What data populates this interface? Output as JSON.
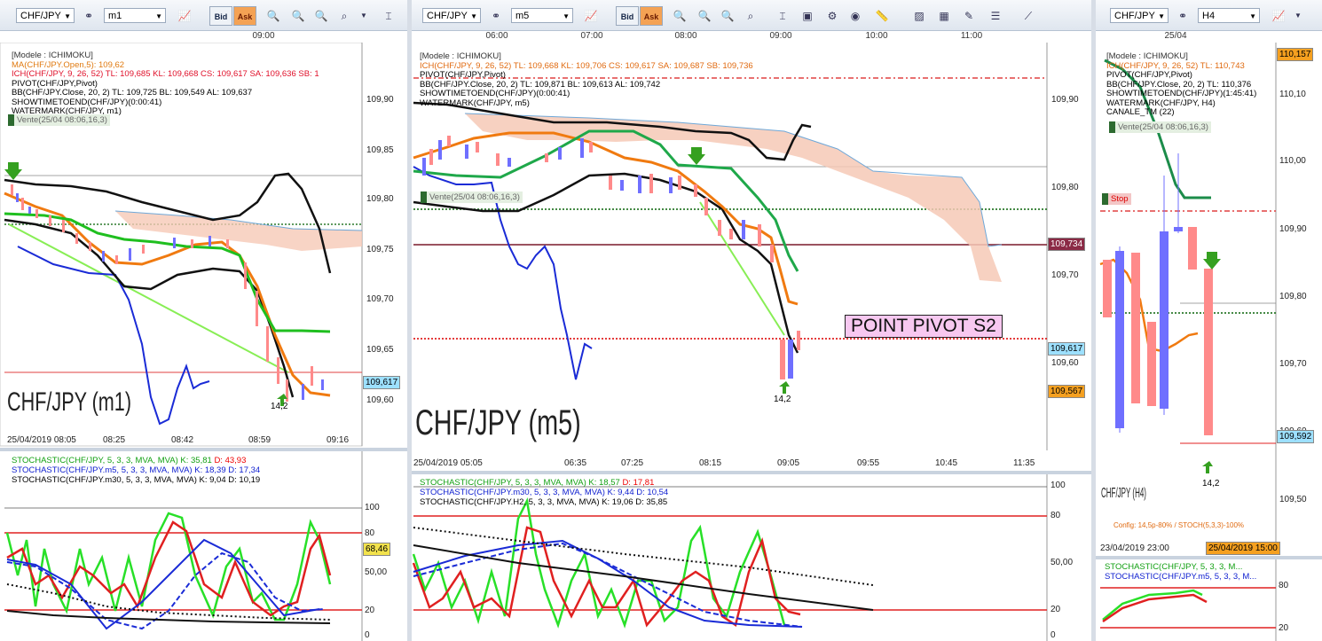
{
  "panels": [
    {
      "symbol": "CHF/JPY",
      "timeframe": "m1",
      "bid_label": "Bid",
      "ask_label": "Ask",
      "top_times": [
        "09:00"
      ],
      "info_lines": [
        "[Modele : ICHIMOKU]",
        "MA(CHF/JPY.Open,5): 109,62",
        "ICH(CHF/JPY, 9, 26, 52)  TL: 109,685  KL: 109,668  CS: 109,617  SA: 109,636  SB: 1",
        "PIVOT(CHF/JPY,Pivot)",
        "BB(CHF/JPY.Close, 20, 2)  TL: 109,725  BL: 109,549  AL: 109,637",
        "SHOWTIMETOEND(CHF/JPY)(0:00:41)",
        "WATERMARK(CHF/JPY, m1)"
      ],
      "vente": "Vente(25/04 08:06,16,3)",
      "y_labels": [
        "109,90",
        "109,85",
        "109,80",
        "109,75",
        "109,70",
        "109,65",
        "109,60"
      ],
      "price_tag": "109,617",
      "watermark": "CHF/JPY (m1)",
      "arrow_label": "14,2",
      "bottom_times": [
        "25/04/2019 08:05",
        "08:25",
        "08:42",
        "08:59",
        "09:16"
      ],
      "stoch_lines": [
        {
          "text": "STOCHASTIC(CHF/JPY, 5, 3, 3, MVA, MVA)",
          "k": "K: 35,81",
          "d": "D: 43,93",
          "color": "#12a012"
        },
        {
          "text": "STOCHASTIC(CHF/JPY.m5, 5, 3, 3, MVA, MVA)",
          "k": "K: 18,39",
          "d": "D: 17,34",
          "color": "#1020d0"
        },
        {
          "text": "STOCHASTIC(CHF/JPY.m30, 5, 3, 3, MVA, MVA)",
          "k": "K: 9,04",
          "d": "D: 10,19",
          "color": "#000000"
        }
      ],
      "stoch_levels": [
        "100",
        "80",
        "50,00",
        "20",
        "0"
      ],
      "stoch_tag": "68,46"
    },
    {
      "symbol": "CHF/JPY",
      "timeframe": "m5",
      "bid_label": "Bid",
      "ask_label": "Ask",
      "top_times": [
        "06:00",
        "07:00",
        "08:00",
        "09:00",
        "10:00",
        "11:00"
      ],
      "info_lines": [
        "[Modele : ICHIMOKU]",
        "ICH(CHF/JPY, 9, 26, 52)  TL: 109,668  KL: 109,706  CS: 109,617  SA: 109,687  SB: 109,736",
        "PIVOT(CHF/JPY,Pivot)",
        "BB(CHF/JPY.Close, 20, 2)  TL: 109,871  BL: 109,613  AL: 109,742",
        "SHOWTIMETOEND(CHF/JPY)(0:00:41)",
        "WATERMARK(CHF/JPY, m5)"
      ],
      "vente": "Vente(25/04 08:06,16,3)",
      "y_labels": [
        "109,90",
        "109,80",
        "109,70",
        "109,60"
      ],
      "price_tags": [
        "109,734",
        "109,617",
        "109,567"
      ],
      "pivot_label": "POINT PIVOT S2",
      "watermark": "CHF/JPY (m5)",
      "arrow_label": "14,2",
      "bottom_times": [
        "25/04/2019 05:05",
        "06:35",
        "07:25",
        "08:15",
        "09:05",
        "09:55",
        "10:45",
        "11:35"
      ],
      "stoch_lines": [
        {
          "text": "STOCHASTIC(CHF/JPY, 5, 3, 3, MVA, MVA)",
          "k": "K: 18,57",
          "d": "D: 17,81",
          "color": "#12a012"
        },
        {
          "text": "STOCHASTIC(CHF/JPY.m30, 5, 3, 3, MVA, MVA)",
          "k": "K: 9,44",
          "d": "D: 10,54",
          "color": "#1020d0"
        },
        {
          "text": "STOCHASTIC(CHF/JPY.H2, 5, 3, 3, MVA, MVA)",
          "k": "K: 19,06",
          "d": "D: 35,85",
          "color": "#000000"
        }
      ],
      "stoch_levels": [
        "100",
        "80",
        "50,00",
        "20",
        "0"
      ]
    },
    {
      "symbol": "CHF/JPY",
      "timeframe": "H4",
      "top_times": [
        "25/04"
      ],
      "info_lines": [
        "[Modele : ICHIMOKU]",
        "ICH(CHF/JPY, 9, 26, 52)  TL: 110,743",
        "PIVOT(CHF/JPY,Pivot)",
        "BB(CHF/JPY.Close, 20, 2)  TL: 110,376",
        "SHOWTIMETOEND(CHF/JPY)(1:45:41)",
        "WATERMARK(CHF/JPY, H4)",
        "CANALE_TM (22)"
      ],
      "vente": "Vente(25/04 08:06,16,3)",
      "stop": "Stop",
      "y_labels": [
        "110,10",
        "110,00",
        "109,90",
        "109,80",
        "109,70",
        "109,60",
        "109,50"
      ],
      "price_tags": [
        "110,157",
        "109,592"
      ],
      "watermark": "CHF/JPY (H4)",
      "arrow_label": "14,2",
      "config": "Config: 14,5p-80% / STOCH(5,3,3)-100%",
      "bottom_times": [
        "23/04/2019 23:00",
        "25/04/2019 15:00"
      ],
      "stoch_lines": [
        {
          "text": "STOCHASTIC(CHF/JPY, 5, 3, 3, M...",
          "color": "#12a012"
        },
        {
          "text": "STOCHASTIC(CHF/JPY.m5, 5, 3, 3, M...",
          "color": "#1020d0"
        }
      ],
      "stoch_levels": [
        "80",
        "20"
      ]
    }
  ]
}
